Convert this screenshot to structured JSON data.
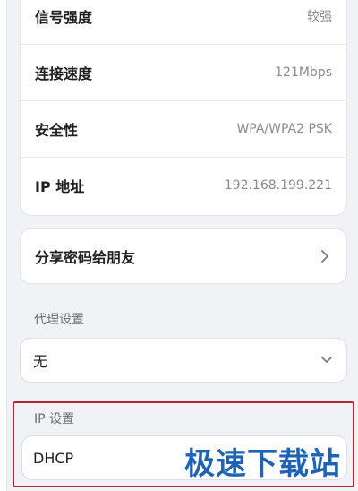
{
  "network_info": {
    "rows": [
      {
        "label": "信号强度",
        "value": "较强"
      },
      {
        "label": "连接速度",
        "value": "121Mbps"
      },
      {
        "label": "安全性",
        "value": "WPA/WPA2 PSK"
      },
      {
        "label": "IP 地址",
        "value": "192.168.199.221"
      }
    ]
  },
  "share": {
    "label": "分享密码给朋友",
    "icon": "chevron-right-icon"
  },
  "proxy": {
    "section_label": "代理设置",
    "selected": "无",
    "icon": "chevron-down-icon"
  },
  "ip_settings": {
    "section_label": "IP 设置",
    "selected": "DHCP",
    "highlight_color": "#b3262d"
  },
  "watermark": {
    "text": "极速下载站",
    "color": "#1e63b5"
  }
}
